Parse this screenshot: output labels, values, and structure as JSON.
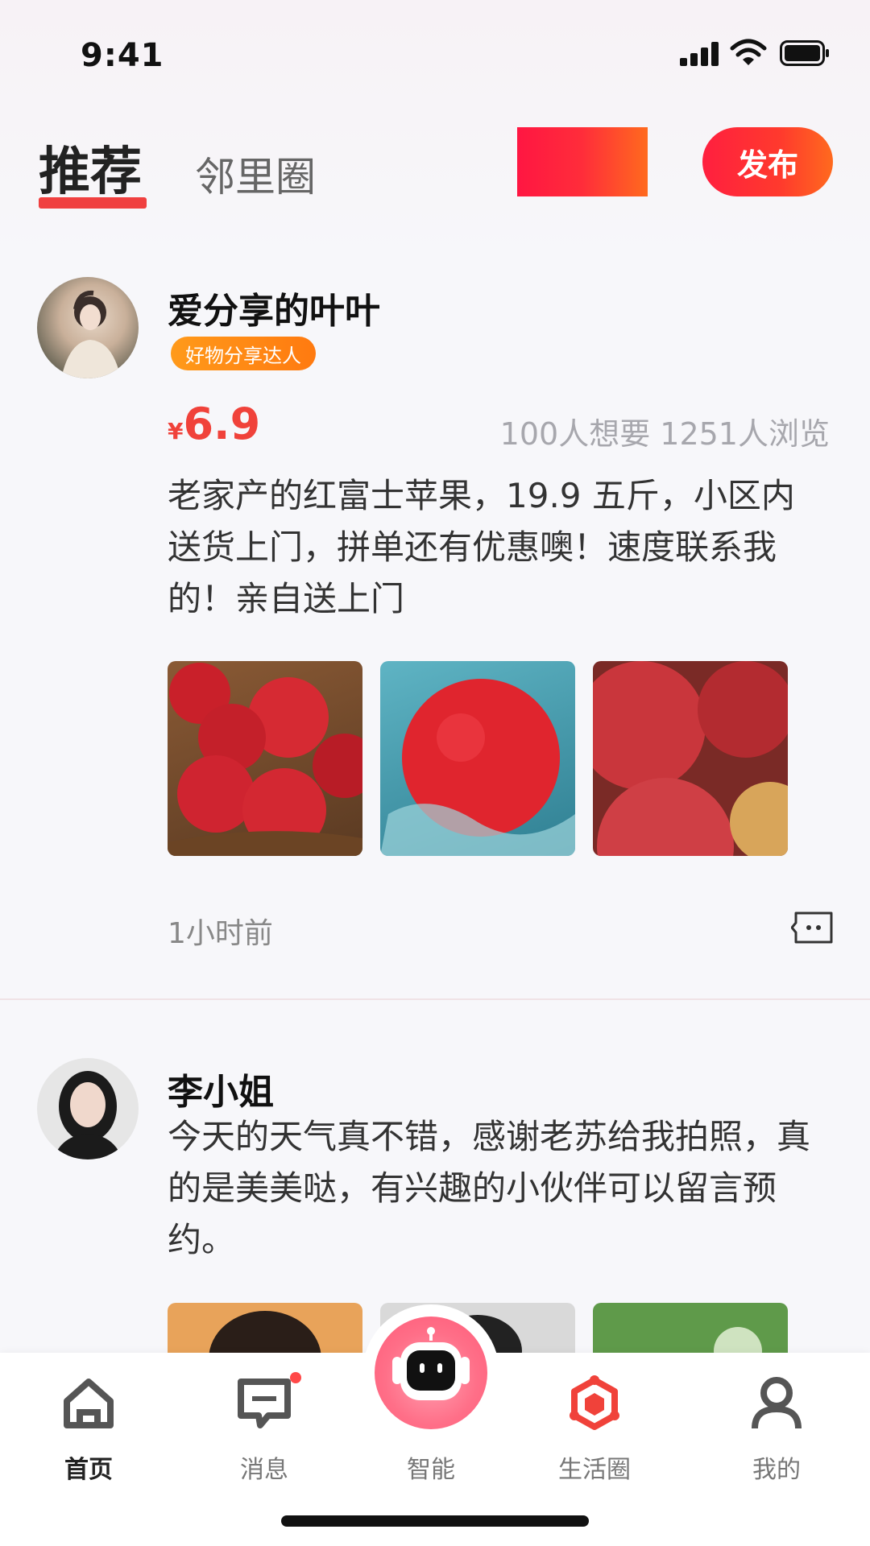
{
  "status_bar": {
    "time": "9:41"
  },
  "header": {
    "tabs": [
      {
        "label": "推荐",
        "active": true
      },
      {
        "label": "邻里圈",
        "active": false
      }
    ],
    "publish_label": "发布"
  },
  "posts": [
    {
      "username": "爱分享的叶叶",
      "badge": "好物分享达人",
      "price_currency": "¥",
      "price_value": "6.9",
      "stats": "100人想要 1251人浏览",
      "text": "老家产的红富士苹果，19.9 五斤，小区内送货上门，拼单还有优惠噢！速度联系我的！亲自送上门",
      "images": [
        "apples-in-basket",
        "apple-splash",
        "apples-closeup"
      ],
      "time": "1小时前"
    },
    {
      "username": "李小姐",
      "text": "今天的天气真不错，感谢老苏给我拍照，真的是美美哒，有兴趣的小伙伴可以留言预约。",
      "images": [
        "portrait-woman",
        "portrait-man",
        "outdoor-grass"
      ]
    }
  ],
  "tabbar": {
    "items": [
      {
        "label": "首页",
        "icon": "home-icon",
        "active": true
      },
      {
        "label": "消息",
        "icon": "message-icon",
        "has_dot": true
      },
      {
        "label": "智能",
        "icon": "robot-icon"
      },
      {
        "label": "生活圈",
        "icon": "life-circle-icon"
      },
      {
        "label": "我的",
        "icon": "user-icon"
      }
    ]
  },
  "colors": {
    "accent": "#f0423a",
    "badge": "#ff8a14",
    "publish": "#ff2d3a"
  }
}
